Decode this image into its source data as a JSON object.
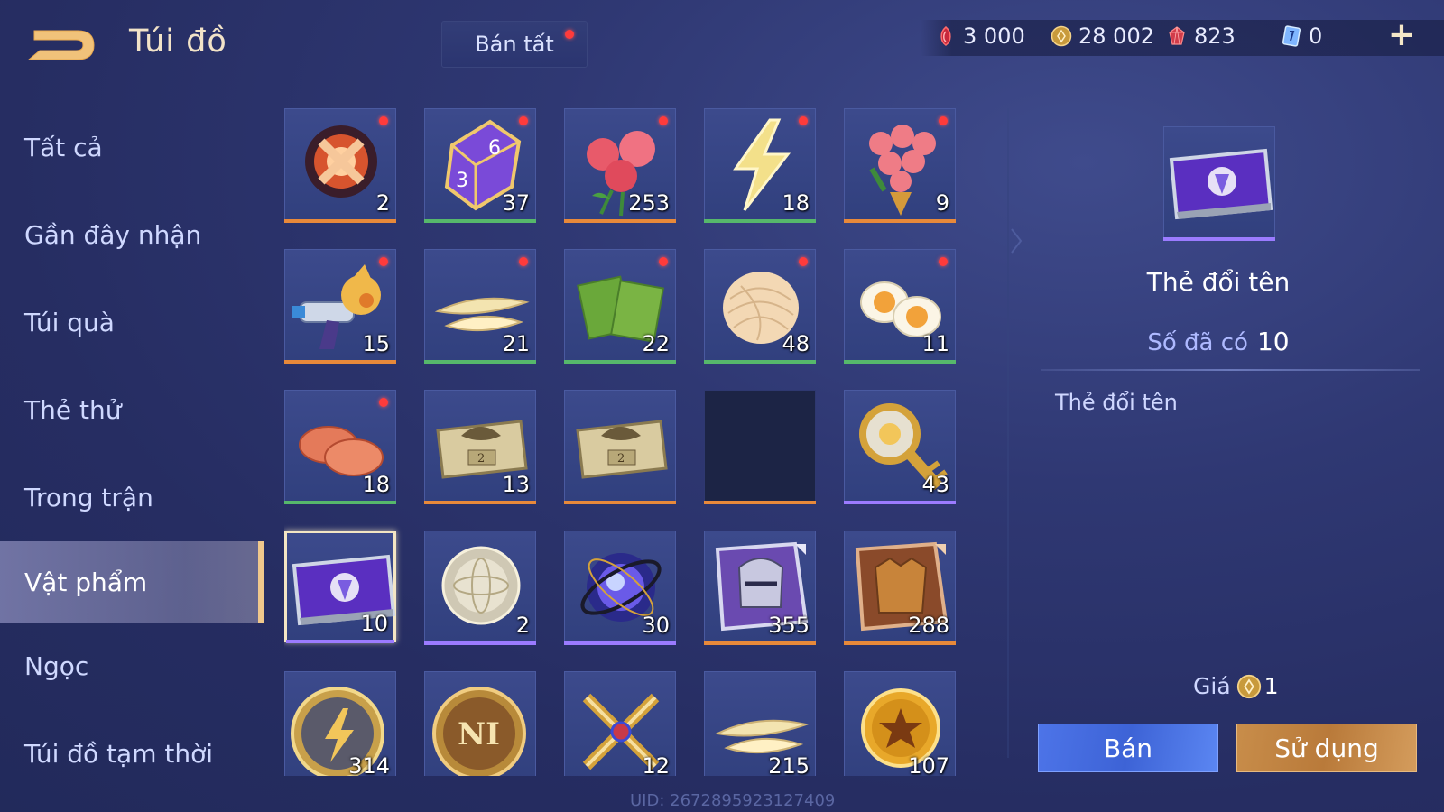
{
  "header": {
    "title": "Túi đồ",
    "sell_all": "Bán tất"
  },
  "currencies": [
    {
      "icon": "red-crystal-icon",
      "value": "3 000"
    },
    {
      "icon": "gold-coin-icon",
      "value": "28 002"
    },
    {
      "icon": "red-gem-icon",
      "value": "823"
    },
    {
      "icon": "blue-card-icon",
      "value": "0"
    }
  ],
  "sidebar": {
    "items": [
      {
        "label": "Tất cả",
        "active": false
      },
      {
        "label": "Gần đây nhận",
        "active": false
      },
      {
        "label": "Túi quà",
        "active": false
      },
      {
        "label": "Thẻ thử",
        "active": false
      },
      {
        "label": "Trong trận",
        "active": false
      },
      {
        "label": "Vật phẩm",
        "active": true
      },
      {
        "label": "Ngọc",
        "active": false
      },
      {
        "label": "Túi đồ tạm thời",
        "active": false
      }
    ]
  },
  "items": [
    {
      "icon": "fire-orb-icon",
      "count": "2",
      "rarity": "orange",
      "new": true
    },
    {
      "icon": "dice-icon",
      "count": "37",
      "rarity": "green",
      "new": true
    },
    {
      "icon": "roses-icon",
      "count": "253",
      "rarity": "orange",
      "new": true
    },
    {
      "icon": "lightning-icon",
      "count": "18",
      "rarity": "green",
      "new": true
    },
    {
      "icon": "rose-bouquet-icon",
      "count": "9",
      "rarity": "orange",
      "new": true
    },
    {
      "icon": "water-gun-icon",
      "count": "15",
      "rarity": "orange",
      "new": true
    },
    {
      "icon": "bamboo-shoot-icon",
      "count": "21",
      "rarity": "green",
      "new": true
    },
    {
      "icon": "seaweed-icon",
      "count": "22",
      "rarity": "green",
      "new": true
    },
    {
      "icon": "noodles-icon",
      "count": "48",
      "rarity": "green",
      "new": true
    },
    {
      "icon": "egg-icon",
      "count": "11",
      "rarity": "green",
      "new": true
    },
    {
      "icon": "sausage-icon",
      "count": "18",
      "rarity": "green",
      "new": true
    },
    {
      "icon": "gold-ticket-icon",
      "count": "13",
      "rarity": "orange",
      "new": false
    },
    {
      "icon": "gold-ticket-icon",
      "count": "",
      "rarity": "orange",
      "new": false
    },
    {
      "icon": "empty-slot-icon",
      "count": "",
      "rarity": "orange",
      "new": false
    },
    {
      "icon": "golden-key-icon",
      "count": "43",
      "rarity": "purple",
      "new": false
    },
    {
      "icon": "rename-card-icon",
      "count": "10",
      "rarity": "purple",
      "new": false,
      "selected": true
    },
    {
      "icon": "silver-orb-icon",
      "count": "2",
      "rarity": "purple",
      "new": false
    },
    {
      "icon": "arcane-sphere-icon",
      "count": "30",
      "rarity": "purple",
      "new": false
    },
    {
      "icon": "helmet-icon",
      "count": "355",
      "rarity": "orange",
      "new": false
    },
    {
      "icon": "armor-icon",
      "count": "288",
      "rarity": "orange",
      "new": false
    },
    {
      "icon": "lightning-coin-icon",
      "count": "314",
      "rarity": "orange",
      "new": false
    },
    {
      "icon": "ni-coin-icon",
      "count": "",
      "rarity": "orange",
      "new": false
    },
    {
      "icon": "crossed-swords-icon",
      "count": "12",
      "rarity": "orange",
      "new": false
    },
    {
      "icon": "bamboo-shoot-icon",
      "count": "215",
      "rarity": "orange",
      "new": false
    },
    {
      "icon": "star-coin-icon",
      "count": "107",
      "rarity": "orange",
      "new": false
    }
  ],
  "detail": {
    "name": "Thẻ đổi tên",
    "owned_label": "Số đã có",
    "owned_value": "10",
    "description": "Thẻ đổi tên",
    "price_label": "Giá",
    "price_value": "1",
    "sell_button": "Bán",
    "use_button": "Sử dụng"
  },
  "uid": "UID: 2672895923127409",
  "colors": {
    "orange": "#e8893a",
    "green": "#56b86b",
    "purple": "#9b7bff",
    "accent": "#f0c88c"
  }
}
